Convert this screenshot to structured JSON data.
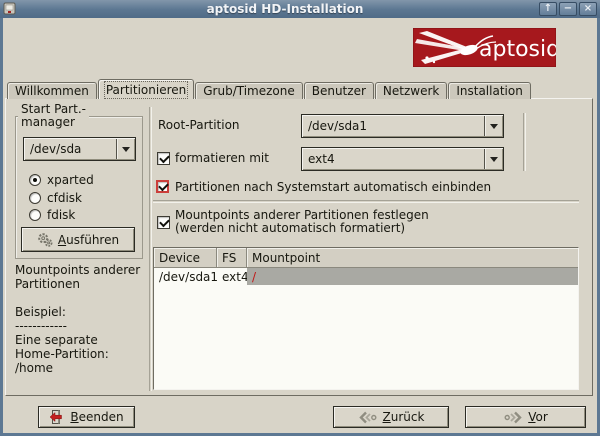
{
  "window": {
    "title": "aptosid HD-Installation",
    "buttons": [
      {
        "name": "shade",
        "glyph": "↑"
      },
      {
        "name": "minimize",
        "glyph": "−"
      },
      {
        "name": "close",
        "glyph": "×"
      }
    ]
  },
  "brand": {
    "name": "aptosid"
  },
  "tabs": [
    {
      "label": "Willkommen",
      "selected": false
    },
    {
      "label": "Partitionieren",
      "selected": true
    },
    {
      "label": "Grub/Timezone",
      "selected": false
    },
    {
      "label": "Benutzer",
      "selected": false
    },
    {
      "label": "Netzwerk",
      "selected": false
    },
    {
      "label": "Installation",
      "selected": false
    }
  ],
  "left_panel": {
    "group_title": "Start Part.-\nmanager",
    "disk_combo": {
      "value": "/dev/sda"
    },
    "radios": [
      {
        "label": "xparted",
        "selected": true
      },
      {
        "label": "cfdisk",
        "selected": false
      },
      {
        "label": "fdisk",
        "selected": false
      }
    ],
    "run_button": {
      "mnemonic": "A",
      "rest": "usführen"
    },
    "info_text": "Mountpoints anderer\nPartitionen\n\nBeispiel:\n------------\nEine separate\nHome-Partition:\n/home"
  },
  "right_panel": {
    "root_partition_label": "Root-Partition",
    "root_partition_combo": {
      "value": "/dev/sda1"
    },
    "format_checkbox": {
      "label": "formatieren mit",
      "checked": true
    },
    "fs_combo": {
      "value": "ext4"
    },
    "automount_checkbox": {
      "label": "Partitionen nach Systemstart automatisch einbinden",
      "checked": true,
      "focused": true
    },
    "mountpoints_checkbox": {
      "label_line1": "Mountpoints anderer Partitionen festlegen",
      "label_line2": "(werden nicht automatisch formatiert)",
      "checked": true
    },
    "table": {
      "headers": [
        "Device",
        "FS",
        "Mountpoint"
      ],
      "rows": [
        {
          "device": "/dev/sda1",
          "fs": "ext4",
          "mountpoint": "/"
        }
      ]
    }
  },
  "footer": {
    "quit_button": {
      "mnemonic": "B",
      "rest": "eenden"
    },
    "back_button": {
      "mnemonic": "Z",
      "rest": "urück"
    },
    "next_button": {
      "mnemonic": "V",
      "rest": "or"
    }
  },
  "colors": {
    "brand_red": "#a6181d",
    "titlebar_blue": "#5d7893",
    "focus_red": "#cb3e3a",
    "selection_gray": "#a9a9a3",
    "mountpoint_red": "#c01818"
  }
}
